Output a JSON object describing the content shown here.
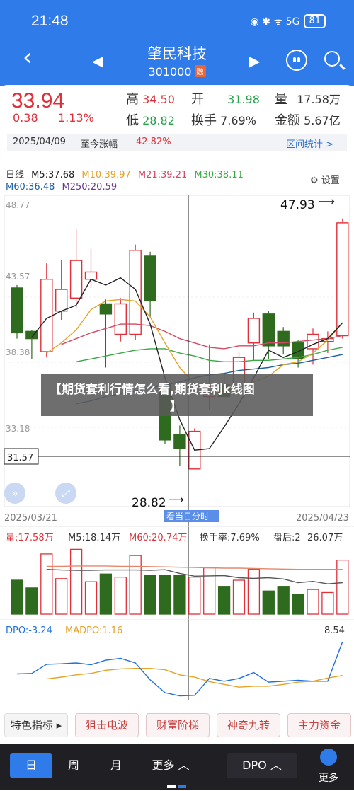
{
  "status": {
    "time": "21:48",
    "battery": "81",
    "icons": "◉ ✱ ᯤ 5G"
  },
  "nav": {
    "title": "肇民科技",
    "code": "301000",
    "tag": "融"
  },
  "quote": {
    "price": "33.94",
    "change": "0.38",
    "pct": "1.13%",
    "high_label": "高",
    "high": "34.50",
    "low_label": "低",
    "low": "28.82",
    "open_label": "开",
    "open": "31.98",
    "turnover_label": "换手",
    "turnover": "7.69%",
    "vol_label": "量",
    "vol": "17.58万",
    "amount_label": "金额",
    "amount": "5.67亿",
    "date": "2025/04/09",
    "ytd_label": "至今涨幅",
    "ytd": "42.82%",
    "range_label": "区间统计 >"
  },
  "kline": {
    "period": "日线",
    "ma5": "M5:37.68",
    "ma10": "M10:39.97",
    "ma21": "M21:39.21",
    "ma30": "M30:38.11",
    "ma60": "M60:36.48",
    "ma250": "M250:20.59",
    "settings": "设置",
    "y_top": "48.77",
    "y_mid1": "43.57",
    "y_mid2": "38.38",
    "y_low": "33.18",
    "cursor_price": "31.57",
    "max_label": "47.93",
    "min_label": "28.82",
    "date_left": "2025/03/21",
    "date_right": "2025/04/23",
    "cursor_tip": "看当日分时"
  },
  "vol": {
    "v": "量:17.58万",
    "m5": "M5:18.14万",
    "m60": "M60:20.74万",
    "turn": "换手率:7.69%",
    "pan": "盘后:2",
    "pan_v": "26.07万"
  },
  "dpo": {
    "dpo": "DPO:-3.24",
    "madpo": "MADPO:1.16",
    "max": "8.54"
  },
  "overlay": {
    "line1": "【期货套利行情怎么看,期货套利k线图",
    "line2": "】"
  },
  "chips": {
    "c0": "特色指标 ▸",
    "c1": "狙击电波",
    "c2": "财富阶梯",
    "c3": "神奇九转",
    "c4": "主力资金"
  },
  "bottom": {
    "b0": "日",
    "b1": "周",
    "b2": "月",
    "b3": "更多 ︿",
    "b4": "DPO ︿",
    "b5": "更多"
  },
  "colors": {
    "up": "#e0303a",
    "down": "#2e6b1e",
    "ma5": "#222222",
    "ma10": "#e3a32b",
    "ma21": "#d14a66",
    "ma30": "#3aa845",
    "ma60": "#1f5fa0",
    "ma250": "#6b3a8c"
  },
  "chart_data": {
    "type": "candlestick",
    "ylim": [
      28.0,
      49.5
    ],
    "candles": [
      {
        "o": 43.1,
        "c": 40.0,
        "h": 43.3,
        "l": 39.6
      },
      {
        "o": 40.1,
        "c": 39.6,
        "h": 40.2,
        "l": 38.2
      },
      {
        "o": 38.7,
        "c": 43.7,
        "h": 44.8,
        "l": 38.3
      },
      {
        "o": 41.5,
        "c": 43.0,
        "h": 45.0,
        "l": 40.9
      },
      {
        "o": 42.4,
        "c": 45.0,
        "h": 47.2,
        "l": 41.7
      },
      {
        "o": 43.7,
        "c": 44.2,
        "h": 45.8,
        "l": 43.1
      },
      {
        "o": 42.0,
        "c": 41.3,
        "h": 42.3,
        "l": 37.6
      },
      {
        "o": 39.9,
        "c": 42.0,
        "h": 42.4,
        "l": 39.4
      },
      {
        "o": 39.9,
        "c": 45.7,
        "h": 46.1,
        "l": 39.5
      },
      {
        "o": 45.3,
        "c": 42.2,
        "h": 45.6,
        "l": 41.1
      },
      {
        "o": 36.4,
        "c": 32.6,
        "h": 36.6,
        "l": 32.3
      },
      {
        "o": 33.0,
        "c": 32.0,
        "h": 33.6,
        "l": 30.8
      },
      {
        "o": 30.6,
        "c": 33.2,
        "h": 33.4,
        "l": 30.6
      },
      {
        "o": 35.6,
        "c": 36.3,
        "h": 39.2,
        "l": 34.7
      },
      {
        "o": 36.4,
        "c": 35.6,
        "h": 37.2,
        "l": 35.4
      },
      {
        "o": 36.2,
        "c": 38.3,
        "h": 38.7,
        "l": 35.8
      },
      {
        "o": 39.3,
        "c": 41.0,
        "h": 41.4,
        "l": 38.1
      },
      {
        "o": 41.3,
        "c": 39.1,
        "h": 41.5,
        "l": 38.2
      },
      {
        "o": 40.1,
        "c": 39.1,
        "h": 40.4,
        "l": 38.5
      },
      {
        "o": 39.3,
        "c": 38.2,
        "h": 39.5,
        "l": 37.6
      },
      {
        "o": 38.9,
        "c": 39.9,
        "h": 40.3,
        "l": 37.8
      },
      {
        "o": 39.4,
        "c": 39.6,
        "h": 40.1,
        "l": 38.6
      },
      {
        "o": 39.8,
        "c": 47.6,
        "h": 47.9,
        "l": 39.6
      }
    ],
    "ma5": [
      39.7,
      41.0,
      41.5,
      41.9,
      43.7,
      43.3,
      43.8,
      43.0,
      40.6,
      36.9,
      34.0,
      31.9,
      32.0,
      33.5,
      35.1,
      36.9,
      38.8,
      38.3,
      38.7,
      39.2,
      39.6,
      40.7
    ],
    "ma10": [
      38.6,
      39.3,
      40.2,
      41.6,
      42.2,
      42.3,
      42.2,
      41.1,
      39.3,
      37.6,
      36.5,
      35.8,
      35.9,
      36.3,
      36.6,
      37.0,
      37.8,
      38.0,
      38.6,
      39.5,
      40.7
    ],
    "ma21": [
      39.2,
      39.6,
      40.0,
      40.3,
      40.6,
      40.6,
      40.5,
      40.1,
      39.6,
      39.3,
      39.0,
      38.9,
      39.1,
      39.1,
      39.3,
      39.3,
      39.4,
      39.5,
      39.6,
      39.8
    ],
    "ma30": [
      38.0,
      38.2,
      38.4,
      38.6,
      38.8,
      38.9,
      38.9,
      38.6,
      38.4,
      38.1,
      38.0,
      38.0,
      38.1,
      38.1,
      38.2,
      38.3,
      38.5,
      38.8,
      39.0
    ],
    "ma60": [
      35.1,
      35.3,
      35.6,
      35.8,
      36.0,
      36.2,
      36.4,
      36.6,
      36.9,
      37.1,
      37.2,
      37.4,
      37.5,
      37.6,
      37.8,
      37.9,
      38.1,
      38.3,
      38.5
    ],
    "volume": [
      11,
      8.5,
      19.5,
      11.5,
      21,
      10.5,
      13,
      12,
      19,
      12.5,
      12.5,
      12.5,
      12,
      15,
      9,
      11,
      14.5,
      7.5,
      9,
      6.5,
      8,
      7,
      17.5
    ],
    "vol_ma": [
      14.5,
      14.3,
      14.2,
      14.2,
      14.3,
      14.3,
      14.3,
      14.2,
      14.4,
      13.2,
      12.3,
      12.4,
      12.5,
      11.8,
      11.6,
      11.8,
      11.4,
      10.2,
      10.6,
      9.8,
      10.2
    ],
    "vol_ma60": [
      15.5,
      15.5,
      15.6,
      15.6,
      15.6,
      15.5,
      15.5,
      15.4,
      15.3,
      15.2,
      15.1,
      15.0,
      14.9,
      14.9,
      14.8,
      14.7,
      14.6,
      14.5,
      14.5,
      14.5,
      14.5
    ],
    "dpo": [
      1.5,
      1.6,
      3.6,
      3.7,
      3.9,
      3.5,
      4.5,
      4.9,
      3.9,
      0.2,
      -2.6,
      -3.3,
      -3.2,
      0.5,
      -0.1,
      0.5,
      1.8,
      -0.3,
      -0.1,
      0.1,
      -0.1,
      -0.1,
      8.54
    ],
    "madpo": [
      0.4,
      0.8,
      1.3,
      1.6,
      2.3,
      2.6,
      2.7,
      2.7,
      2.4,
      1.3,
      0.8,
      -0.2,
      -0.8,
      -1.4,
      -1.2,
      -1.2,
      -0.8,
      -0.3,
      -0.1,
      0.6,
      1.16
    ]
  }
}
